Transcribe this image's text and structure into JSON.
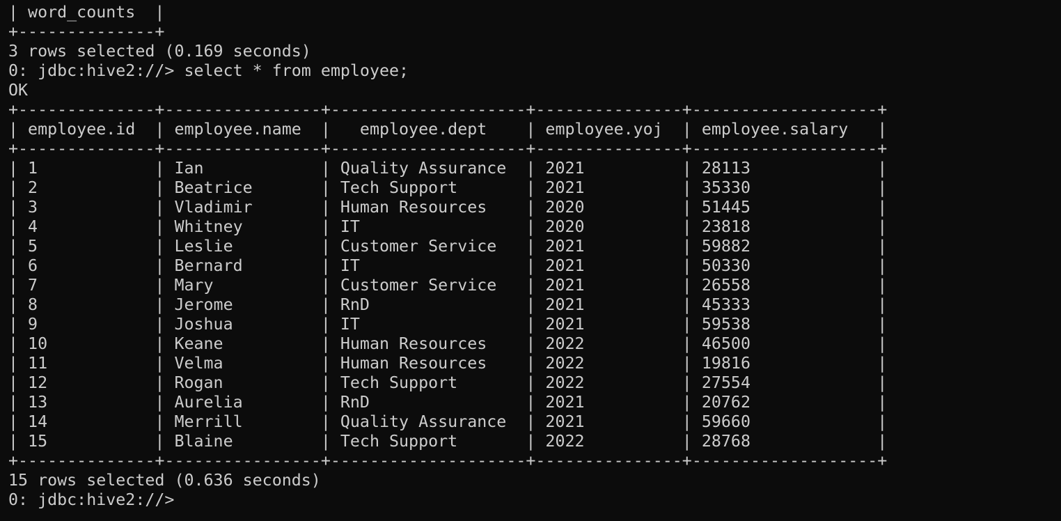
{
  "terminal": {
    "lines": [
      "| word_counts  |",
      "+--------------+",
      "3 rows selected (0.169 seconds)",
      "0: jdbc:hive2://> select * from employee;",
      "OK",
      "+--------------+----------------+--------------------+---------------+-------------------+",
      "| employee.id  | employee.name  |   employee.dept    | employee.yoj  | employee.salary   |",
      "+--------------+----------------+--------------------+---------------+-------------------+",
      "| 1            | Ian            | Quality Assurance  | 2021          | 28113             |",
      "| 2            | Beatrice       | Tech Support       | 2021          | 35330             |",
      "| 3            | Vladimir       | Human Resources    | 2020          | 51445             |",
      "| 4            | Whitney        | IT                 | 2020          | 23818             |",
      "| 5            | Leslie         | Customer Service   | 2021          | 59882             |",
      "| 6            | Bernard        | IT                 | 2021          | 50330             |",
      "| 7            | Mary           | Customer Service   | 2021          | 26558             |",
      "| 8            | Jerome         | RnD                | 2021          | 45333             |",
      "| 9            | Joshua         | IT                 | 2021          | 59538             |",
      "| 10           | Keane          | Human Resources    | 2022          | 46500             |",
      "| 11           | Velma          | Human Resources    | 2022          | 19816             |",
      "| 12           | Rogan          | Tech Support       | 2022          | 27554             |",
      "| 13           | Aurelia        | RnD                | 2021          | 20762             |",
      "| 14           | Merrill        | Quality Assurance  | 2021          | 59660             |",
      "| 15           | Blaine         | Tech Support       | 2022          | 28768             |",
      "+--------------+----------------+--------------------+---------------+-------------------+",
      "15 rows selected (0.636 seconds)",
      "0: jdbc:hive2://> "
    ]
  },
  "colors": {
    "background": "#0c0c0c",
    "text": "#cccccc"
  }
}
